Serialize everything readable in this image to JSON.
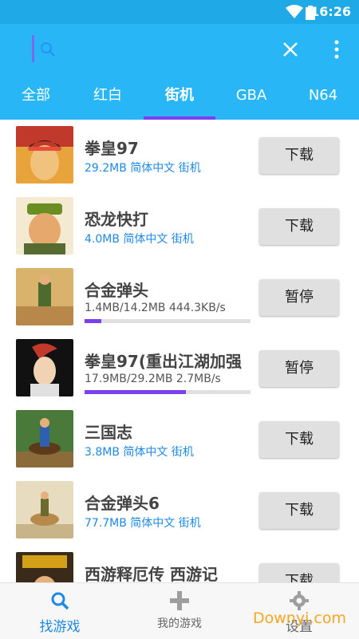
{
  "status": {
    "time": "16:26"
  },
  "search": {
    "placeholder": ""
  },
  "tabs": [
    {
      "label": "全部"
    },
    {
      "label": "红白"
    },
    {
      "label": "街机"
    },
    {
      "label": "GBA"
    },
    {
      "label": "N64"
    }
  ],
  "active_tab": "街机",
  "games": [
    {
      "title": "拳皇97",
      "meta": "29.2MB 简体中文 街机",
      "button": "下载"
    },
    {
      "title": "恐龙快打",
      "meta": "4.0MB 简体中文 街机",
      "button": "下载"
    },
    {
      "title": "合金弹头",
      "meta": "1.4MB/14.2MB  444.3KB/s",
      "progress": 0.1,
      "button": "暂停"
    },
    {
      "title": "拳皇97(重出江湖加强",
      "meta": "17.9MB/29.2MB  2.7MB/s",
      "progress": 0.61,
      "button": "暂停"
    },
    {
      "title": "三国志",
      "meta": "3.8MB 简体中文 街机",
      "button": "下载"
    },
    {
      "title": "合金弹头6",
      "meta": "77.7MB 简体中文 街机",
      "button": "下载"
    },
    {
      "title": "西游释厄传 西游记",
      "meta": "",
      "button": "下载"
    }
  ],
  "bottom_nav": [
    {
      "label": "找游戏",
      "active": true
    },
    {
      "label": "我的游戏",
      "active": false
    },
    {
      "label": "设置",
      "active": false
    }
  ],
  "watermark": "Downyi.com",
  "colors": {
    "primary": "#29b6f6",
    "accent": "#7b3ff2",
    "link": "#1e88e5",
    "watermark": "#f5a623"
  }
}
